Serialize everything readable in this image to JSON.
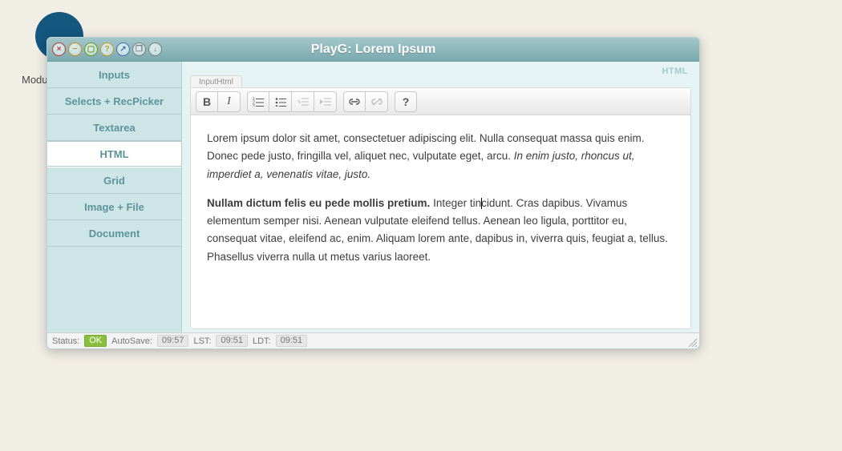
{
  "background_label": "Modu",
  "window": {
    "title": "PlayG: Lorem Ipsum",
    "title_icons": {
      "close": "×",
      "min": "−",
      "save": "▢",
      "help": "?",
      "max": "↗",
      "copy": "❐",
      "down": "↓"
    }
  },
  "sidebar": {
    "items": [
      {
        "label": "Inputs",
        "active": false
      },
      {
        "label": "Selects + RecPicker",
        "active": false
      },
      {
        "label": "Textarea",
        "active": false
      },
      {
        "label": "HTML",
        "active": true
      },
      {
        "label": "Grid",
        "active": false
      },
      {
        "label": "Image + File",
        "active": false
      },
      {
        "label": "Document",
        "active": false
      }
    ]
  },
  "main": {
    "corner_label": "HTML",
    "tab_label": "InputHtml",
    "toolbar_names": [
      "bold",
      "italic",
      "ol",
      "ul",
      "outdent",
      "indent",
      "link",
      "unlink",
      "help"
    ],
    "content": {
      "p1_a": "Lorem ipsum dolor sit amet, consectetuer adipiscing elit. Nulla consequat massa quis enim. Donec pede justo, fringilla vel, aliquet nec, vulputate eget, arcu. ",
      "p1_em": "In enim justo, rhoncus ut, imperdiet a, venenatis vitae, justo.",
      "p2_bold": "Nullam dictum felis eu pede mollis pretium.",
      "p2_before": " Integer tin",
      "p2_after": "cidunt. Cras dapibus. Vivamus elementum semper nisi. Aenean vulputate eleifend tellus. Aenean leo ligula, porttitor eu, consequat vitae, eleifend ac, enim. Aliquam lorem ante, dapibus in, viverra quis, feugiat a, tellus. Phasellus viverra nulla ut metus varius laoreet."
    }
  },
  "status": {
    "label_status": "Status:",
    "status_value": "OK",
    "label_autosave": "AutoSave:",
    "autosave_time": "09:57",
    "label_lst": "LST:",
    "lst_time": "09:51",
    "label_ldt": "LDT:",
    "ldt_time": "09:51"
  }
}
